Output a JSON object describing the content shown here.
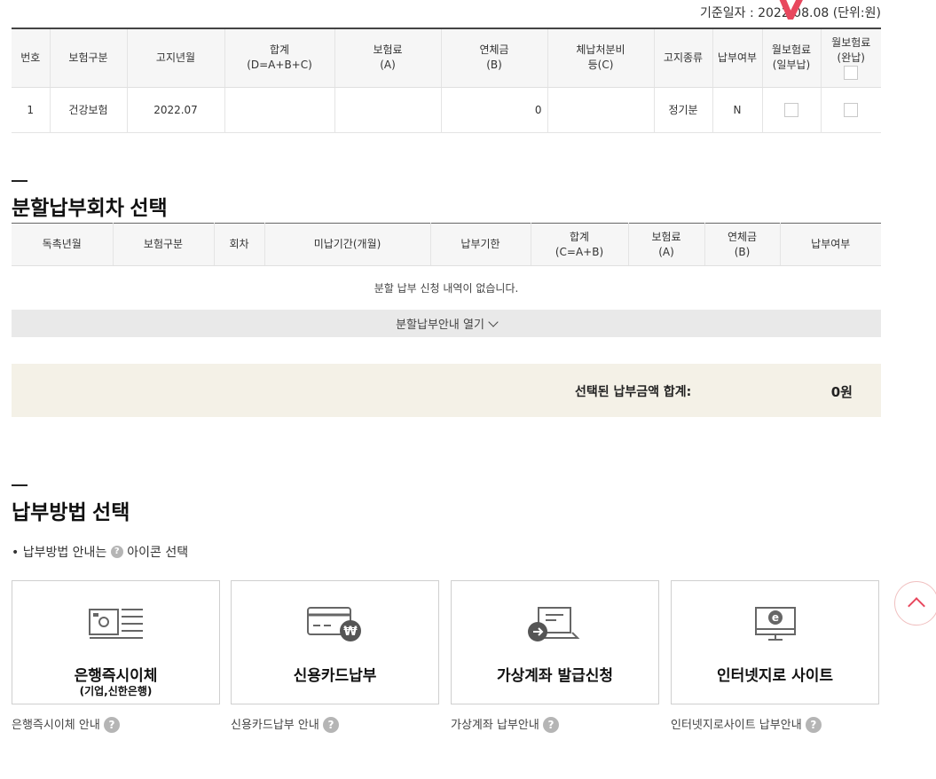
{
  "header": {
    "ref_date": "기준일자 : 2022.08.08 (단위:원)"
  },
  "notice_table": {
    "columns": [
      {
        "l1": "번호",
        "l2": ""
      },
      {
        "l1": "보험구분",
        "l2": ""
      },
      {
        "l1": "고지년월",
        "l2": ""
      },
      {
        "l1": "합계",
        "l2": "(D=A+B+C)"
      },
      {
        "l1": "보험료",
        "l2": "(A)"
      },
      {
        "l1": "연체금",
        "l2": "(B)"
      },
      {
        "l1": "체납처분비",
        "l2": "등(C)"
      },
      {
        "l1": "고지종류",
        "l2": ""
      },
      {
        "l1": "납부여부",
        "l2": ""
      },
      {
        "l1": "월보험료",
        "l2": "(일부납)"
      },
      {
        "l1": "월보험료",
        "l2": "(완납)"
      }
    ],
    "row": {
      "no": "1",
      "type": "건강보험",
      "month": "2022.07",
      "total": "",
      "premium": "",
      "overdue": "0",
      "fee": "",
      "kind": "정기분",
      "paid": "N"
    }
  },
  "installment": {
    "title": "분할납부회차 선택",
    "columns": [
      {
        "l1": "독촉년월",
        "l2": ""
      },
      {
        "l1": "보험구분",
        "l2": ""
      },
      {
        "l1": "회차",
        "l2": ""
      },
      {
        "l1": "미납기간(개월)",
        "l2": ""
      },
      {
        "l1": "납부기한",
        "l2": ""
      },
      {
        "l1": "합계",
        "l2": "(C=A+B)"
      },
      {
        "l1": "보험료",
        "l2": "(A)"
      },
      {
        "l1": "연체금",
        "l2": "(B)"
      },
      {
        "l1": "납부여부",
        "l2": ""
      }
    ],
    "empty_message": "분할 납부 신청 내역이 없습니다.",
    "guide_toggle": "분할납부안내 열기"
  },
  "summary": {
    "label": "선택된 납부금액 합계:",
    "value": "0원"
  },
  "payment": {
    "title": "납부방법 선택",
    "info_prefix": "• 납부방법 안내는",
    "info_suffix": "아이콘 선택",
    "methods": [
      {
        "label": "은행즉시이체",
        "sub": "(기업,신한은행)",
        "guide": "은행즉시이체 안내",
        "icon": "bank-transfer-icon"
      },
      {
        "label": "신용카드납부",
        "sub": "",
        "guide": "신용카드납부 안내",
        "icon": "credit-card-won-icon"
      },
      {
        "label": "가상계좌 발급신청",
        "sub": "",
        "guide": "가상계좌 납부안내",
        "icon": "virtual-account-icon"
      },
      {
        "label": "인터넷지로 사이트",
        "sub": "",
        "guide": "인터넷지로사이트 납부안내",
        "icon": "internet-giro-icon"
      }
    ]
  },
  "colors": {
    "accent_red": "#e8485e",
    "summary_bg": "#f4f1e7",
    "guide_bar_bg": "#e9e9e9"
  }
}
